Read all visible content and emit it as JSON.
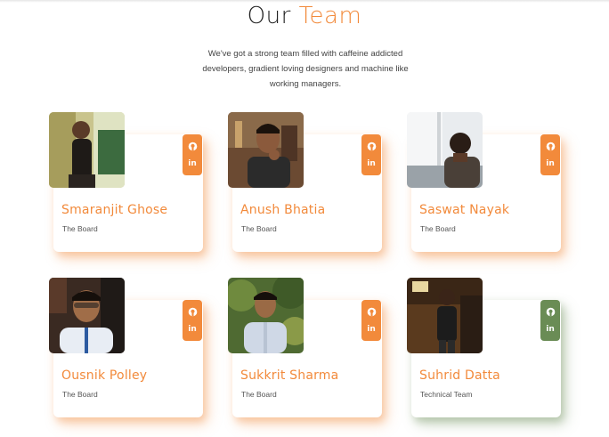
{
  "header": {
    "title_main": "Our",
    "title_accent": "Team",
    "subtitle": "We've got a strong team filled with caffeine addicted developers, gradient loving designers and machine like working managers."
  },
  "colors": {
    "accent": "#f28a3b",
    "accent_alt": "#6a8c55",
    "text": "#222222"
  },
  "members": [
    {
      "name": "Smaranjit Ghose",
      "role": "The Board",
      "icons": [
        "github-icon",
        "linkedin-icon"
      ]
    },
    {
      "name": "Anush Bhatia",
      "role": "The Board",
      "icons": [
        "github-icon",
        "linkedin-icon"
      ]
    },
    {
      "name": "Saswat Nayak",
      "role": "The Board",
      "icons": [
        "github-icon",
        "linkedin-icon"
      ]
    },
    {
      "name": "Ousnik Polley",
      "role": "The Board",
      "icons": [
        "github-icon",
        "linkedin-icon"
      ]
    },
    {
      "name": "Sukkrit Sharma",
      "role": "The Board",
      "icons": [
        "github-icon",
        "linkedin-icon"
      ]
    },
    {
      "name": "Suhrid Datta",
      "role": "Technical Team",
      "icons": [
        "github-icon",
        "linkedin-icon"
      ]
    }
  ]
}
